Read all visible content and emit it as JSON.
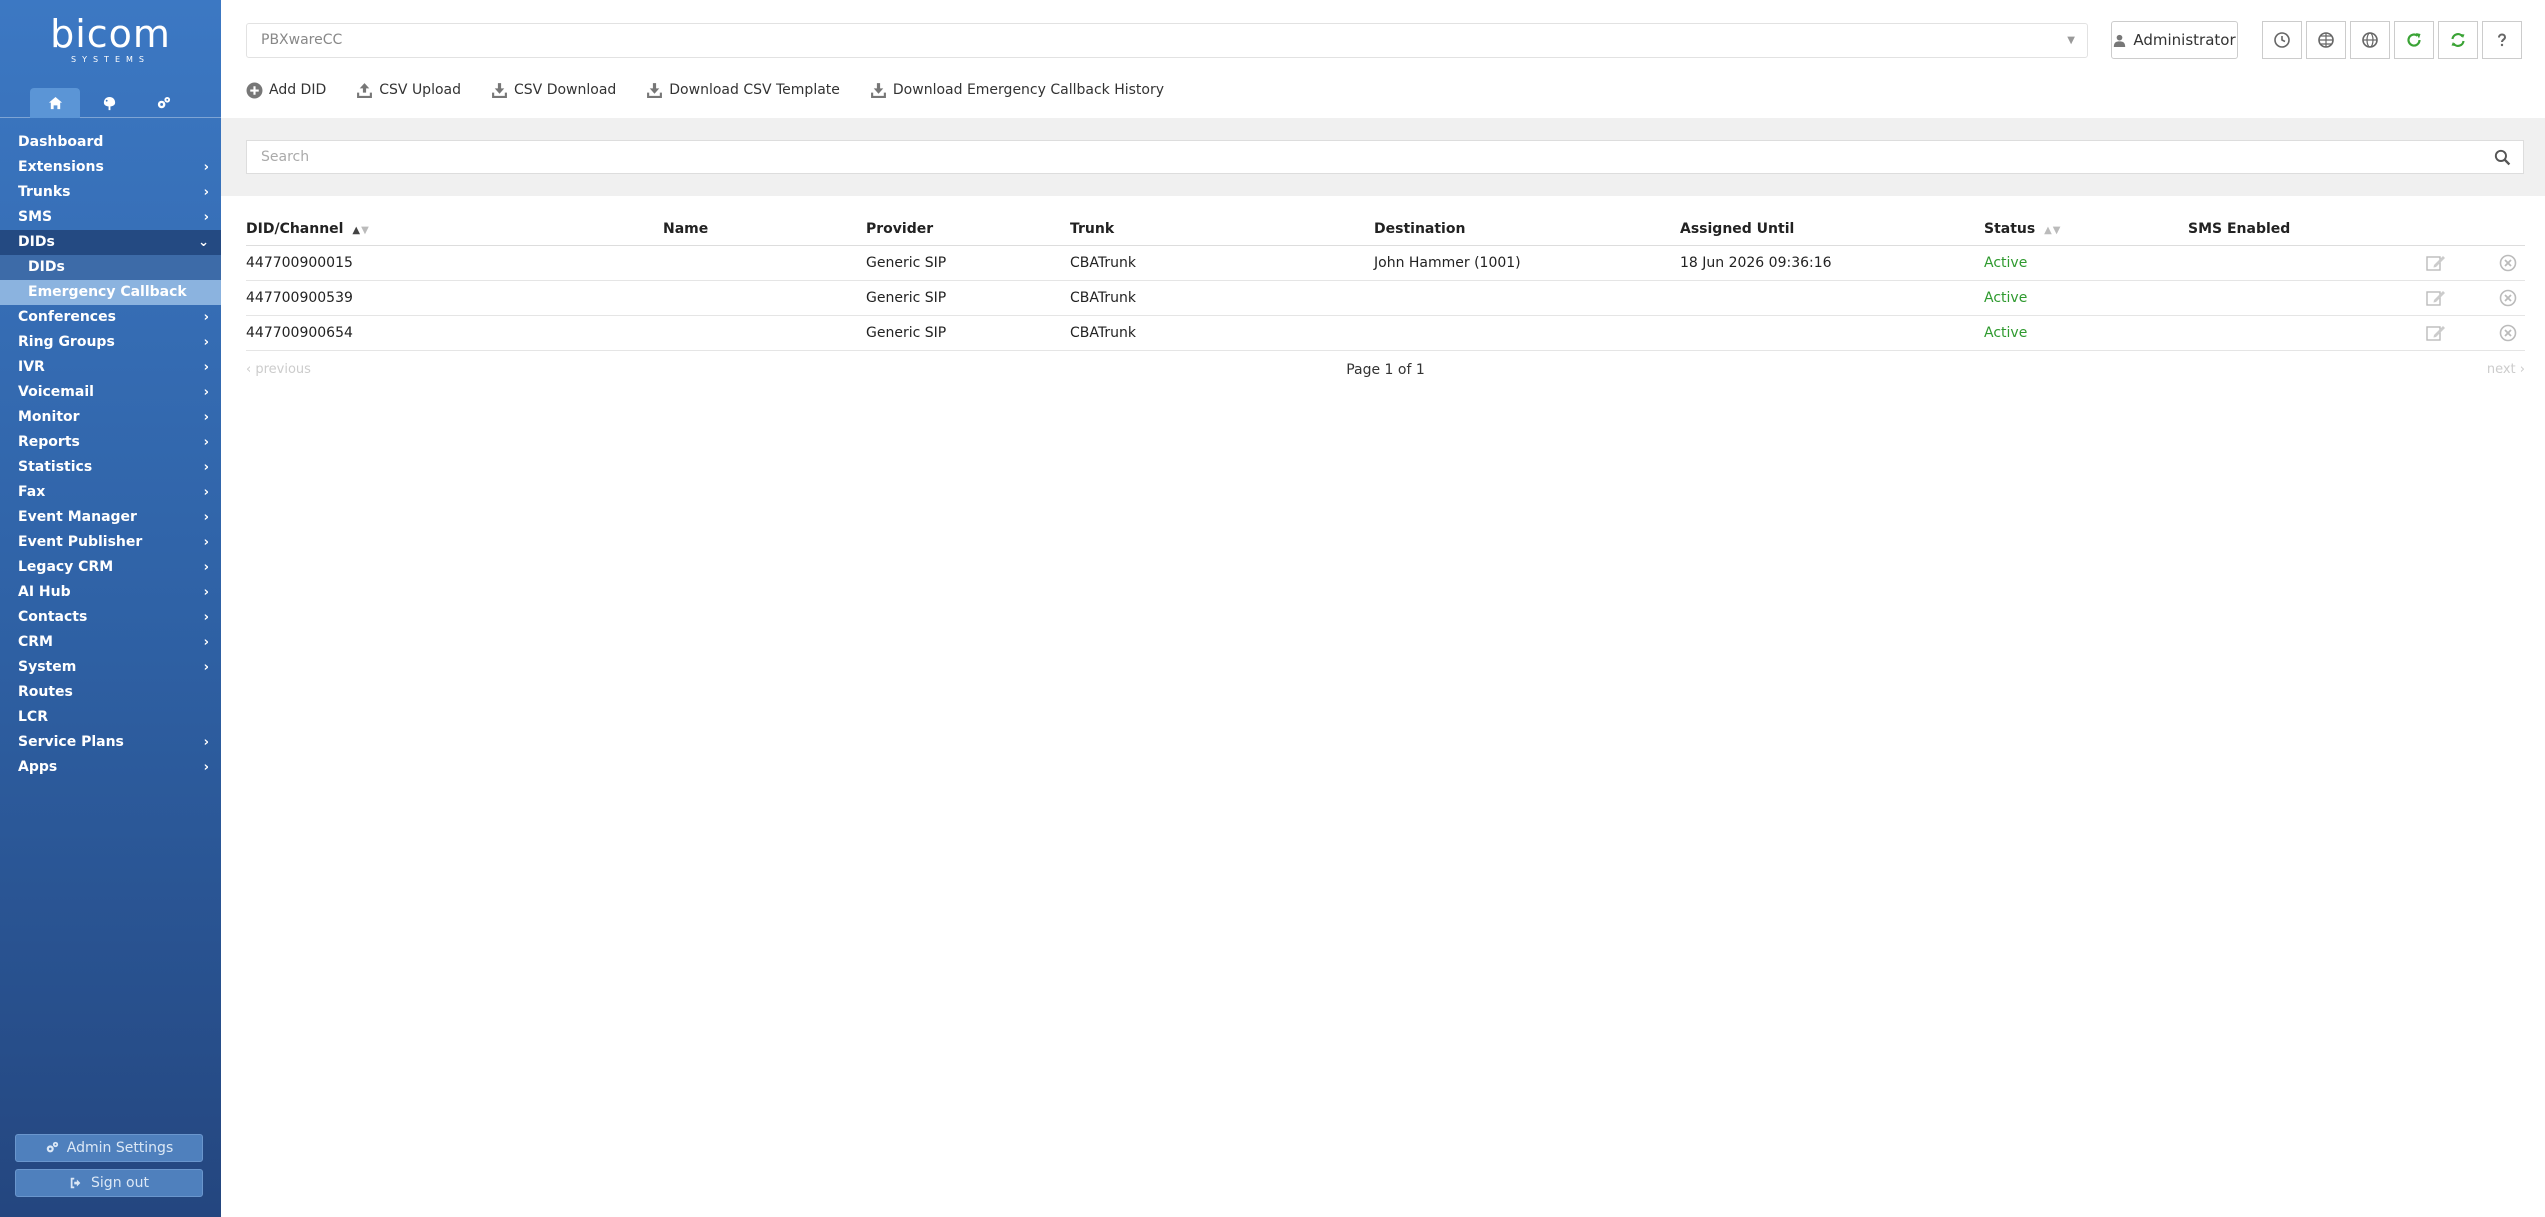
{
  "logo": {
    "text": "bicom",
    "subtext": "SYSTEMS"
  },
  "sidebar": {
    "tabs": [
      {
        "icon": "home-icon"
      },
      {
        "icon": "palette-icon"
      },
      {
        "icon": "gears-icon"
      }
    ],
    "items": [
      {
        "label": "Dashboard",
        "chevron": false
      },
      {
        "label": "Extensions",
        "chevron": true
      },
      {
        "label": "Trunks",
        "chevron": true
      },
      {
        "label": "SMS",
        "chevron": true
      },
      {
        "label": "DIDs",
        "chevron": true,
        "open": true
      },
      {
        "label": "Conferences",
        "chevron": true
      },
      {
        "label": "Ring Groups",
        "chevron": true
      },
      {
        "label": "IVR",
        "chevron": true
      },
      {
        "label": "Voicemail",
        "chevron": true
      },
      {
        "label": "Monitor",
        "chevron": true
      },
      {
        "label": "Reports",
        "chevron": true
      },
      {
        "label": "Statistics",
        "chevron": true
      },
      {
        "label": "Fax",
        "chevron": true
      },
      {
        "label": "Event Manager",
        "chevron": true
      },
      {
        "label": "Event Publisher",
        "chevron": true
      },
      {
        "label": "Legacy CRM",
        "chevron": true
      },
      {
        "label": "AI Hub",
        "chevron": true
      },
      {
        "label": "Contacts",
        "chevron": true
      },
      {
        "label": "CRM",
        "chevron": true
      },
      {
        "label": "System",
        "chevron": true
      },
      {
        "label": "Routes",
        "chevron": false
      },
      {
        "label": "LCR",
        "chevron": false
      },
      {
        "label": "Service Plans",
        "chevron": true
      },
      {
        "label": "Apps",
        "chevron": true
      }
    ],
    "dids_sub": [
      {
        "label": "DIDs"
      },
      {
        "label": "Emergency Callback",
        "active": true
      }
    ],
    "admin_settings": "Admin Settings",
    "sign_out": "Sign out"
  },
  "topbar": {
    "tenant": "PBXwareCC",
    "user": "Administrator",
    "icons": [
      "clock-icon",
      "globe-grid-icon",
      "globe-icon",
      "refresh-icon",
      "sync-icon",
      "help-icon"
    ]
  },
  "actions": [
    {
      "label": "Add DID",
      "icon": "plus-circle-icon"
    },
    {
      "label": "CSV Upload",
      "icon": "upload-icon"
    },
    {
      "label": "CSV Download",
      "icon": "download-icon"
    },
    {
      "label": "Download CSV Template",
      "icon": "download-icon"
    },
    {
      "label": "Download Emergency Callback History",
      "icon": "download-icon"
    }
  ],
  "search": {
    "placeholder": "Search"
  },
  "table": {
    "headers": {
      "did": "DID/Channel",
      "name": "Name",
      "provider": "Provider",
      "trunk": "Trunk",
      "destination": "Destination",
      "assigned": "Assigned Until",
      "status": "Status",
      "sms": "SMS Enabled"
    },
    "rows": [
      {
        "did": "447700900015",
        "name": "",
        "provider": "Generic SIP",
        "trunk": "CBATrunk",
        "destination": "John Hammer (1001)",
        "assigned": "18 Jun 2026 09:36:16",
        "status": "Active",
        "sms": ""
      },
      {
        "did": "447700900539",
        "name": "",
        "provider": "Generic SIP",
        "trunk": "CBATrunk",
        "destination": "",
        "assigned": "",
        "status": "Active",
        "sms": ""
      },
      {
        "did": "447700900654",
        "name": "",
        "provider": "Generic SIP",
        "trunk": "CBATrunk",
        "destination": "",
        "assigned": "",
        "status": "Active",
        "sms": ""
      }
    ]
  },
  "pager": {
    "previous": "previous",
    "page": "Page 1 of 1",
    "next": "next"
  },
  "colors": {
    "sidebar_top": "#3c78c3",
    "sidebar_bottom": "#24467f",
    "active_status": "#2f9a2f",
    "refresh_green": "#3aa335"
  }
}
